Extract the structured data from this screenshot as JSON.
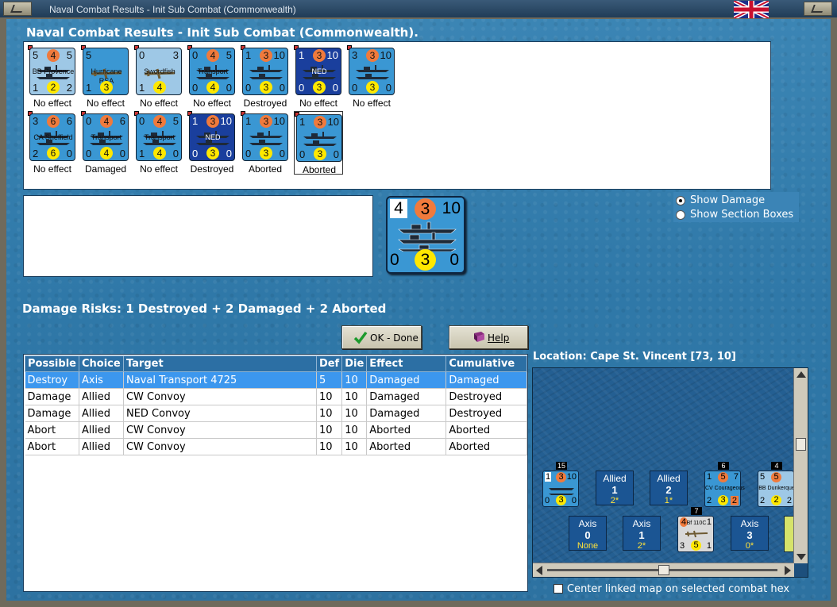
{
  "window": {
    "title": "Naval Combat Results - Init Sub Combat (Commonwealth)"
  },
  "heading": "Naval Combat Results - Init Sub Combat (Commonwealth).",
  "units_row1": [
    {
      "tl": "5",
      "tc": "4",
      "tr": "5",
      "name": "BB Provence",
      "bl": "1",
      "bc": "2",
      "br": "2",
      "style": "light",
      "caption": "No effect"
    },
    {
      "tl": "5",
      "tc": "",
      "tr": "",
      "name": "Hurricane",
      "name2": "RSA",
      "bl": "1",
      "bc": "3",
      "br": "",
      "style": "mid",
      "caption": "No effect"
    },
    {
      "tl": "0",
      "tc": "",
      "tr": "3",
      "name": "Swordfish",
      "bl": "1",
      "bc": "4",
      "br": "",
      "style": "light",
      "caption": "No effect"
    },
    {
      "tl": "0",
      "tc": "4",
      "tr": "5",
      "name": "Transport",
      "bl": "0",
      "bc": "4",
      "br": "0",
      "style": "mid",
      "caption": "No effect"
    },
    {
      "tl": "1",
      "tc": "3",
      "tr": "10",
      "name": "",
      "bl": "0",
      "bc": "3",
      "br": "0",
      "style": "mid",
      "caption": "Destroyed"
    },
    {
      "tl": "1",
      "tc": "3",
      "tr": "10",
      "name": "NED",
      "bl": "0",
      "bc": "3",
      "br": "0",
      "style": "dark",
      "caption": "No effect"
    },
    {
      "tl": "3",
      "tc": "3",
      "tr": "10",
      "name": "",
      "bl": "0",
      "bc": "3",
      "br": "0",
      "style": "mid",
      "caption": "No effect"
    }
  ],
  "units_row2": [
    {
      "tl": "3",
      "tc": "6",
      "tr": "6",
      "name": "CA Sheffield",
      "bl": "2",
      "bc": "6",
      "br": "0",
      "style": "mid",
      "caption": "No effect"
    },
    {
      "tl": "0",
      "tc": "4",
      "tr": "6",
      "name": "Transport",
      "bl": "0",
      "bc": "4",
      "br": "0",
      "style": "mid",
      "caption": "Damaged"
    },
    {
      "tl": "0",
      "tc": "4",
      "tr": "5",
      "name": "Transport",
      "bl": "1",
      "bc": "4",
      "br": "0",
      "style": "mid",
      "caption": "No effect"
    },
    {
      "tl": "1",
      "tc": "3",
      "tr": "10",
      "name": "NED",
      "bl": "0",
      "bc": "3",
      "br": "0",
      "style": "dark",
      "caption": "Destroyed"
    },
    {
      "tl": "1",
      "tc": "3",
      "tr": "10",
      "name": "",
      "bl": "0",
      "bc": "3",
      "br": "0",
      "style": "mid",
      "caption": "Aborted"
    },
    {
      "tl": "1",
      "tc": "3",
      "tr": "10",
      "name": "",
      "bl": "0",
      "bc": "3",
      "br": "0",
      "style": "mid",
      "caption": "Aborted",
      "selected": true
    }
  ],
  "big_counter": {
    "tl": "4",
    "tc": "3",
    "tr": "10",
    "bl": "0",
    "bc": "3",
    "br": "0"
  },
  "radio": {
    "show_damage": "Show Damage",
    "show_section_boxes": "Show Section Boxes",
    "selected": "show_damage"
  },
  "damage_risks": "Damage Risks:  1 Destroyed + 2 Damaged + 2 Aborted",
  "buttons": {
    "ok": "OK - Done",
    "help": "Help"
  },
  "table": {
    "headers": [
      "Possible",
      "Choice",
      "Target",
      "Def",
      "Die",
      "Effect",
      "Cumulative"
    ],
    "rows": [
      [
        "Destroy",
        "Axis",
        " Naval Transport 4725",
        "5",
        "10",
        "Damaged",
        "Damaged"
      ],
      [
        "Damage",
        "Allied",
        "CW Convoy",
        "10",
        "10",
        "Damaged",
        "Destroyed"
      ],
      [
        "Damage",
        "Allied",
        "NED Convoy",
        "10",
        "10",
        "Damaged",
        "Destroyed"
      ],
      [
        "Abort",
        "Allied",
        "CW Convoy",
        "10",
        "10",
        "Aborted",
        "Aborted"
      ],
      [
        "Abort",
        "Allied",
        "CW Convoy",
        "10",
        "10",
        "Aborted",
        "Aborted"
      ]
    ],
    "selected_row": 0
  },
  "location": "Location:  Cape St. Vincent [73, 10]",
  "map": {
    "stack_15": {
      "badge": "15",
      "tl": "1",
      "tc": "3",
      "tr": "10",
      "bl": "0",
      "bc": "3",
      "br": "0"
    },
    "allied_1": {
      "side": "Allied",
      "num": "1",
      "val": "2*"
    },
    "allied_2": {
      "side": "Allied",
      "num": "2",
      "val": "1*"
    },
    "stack_6": {
      "badge": "6",
      "tl": "1",
      "tc": "5",
      "tr": "7",
      "name": "CV Courageous",
      "bl": "2",
      "bc": "3",
      "br": "2"
    },
    "stack_4": {
      "badge": "4",
      "tl": "5",
      "tc": "5",
      "tr": "",
      "name": "BB Dunkerque",
      "bl": "2",
      "bc": "2",
      "br": "2"
    },
    "axis_0": {
      "side": "Axis",
      "num": "0",
      "val": "None"
    },
    "axis_1": {
      "side": "Axis",
      "num": "1",
      "val": "2*"
    },
    "stack_7": {
      "badge": "7",
      "tl": "4",
      "tc": "",
      "tr": "1",
      "name": "Bf 110C",
      "bl": "3",
      "bc": "5",
      "br": "1"
    },
    "axis_3": {
      "side": "Axis",
      "num": "3",
      "val": "0*"
    }
  },
  "center_check": "Center linked map on selected combat hex",
  "colors": {
    "selection": "#3c97ee",
    "header": "#2c6fa4",
    "attack_circle": "#f07a3c",
    "defense_circle": "#ffe800"
  }
}
